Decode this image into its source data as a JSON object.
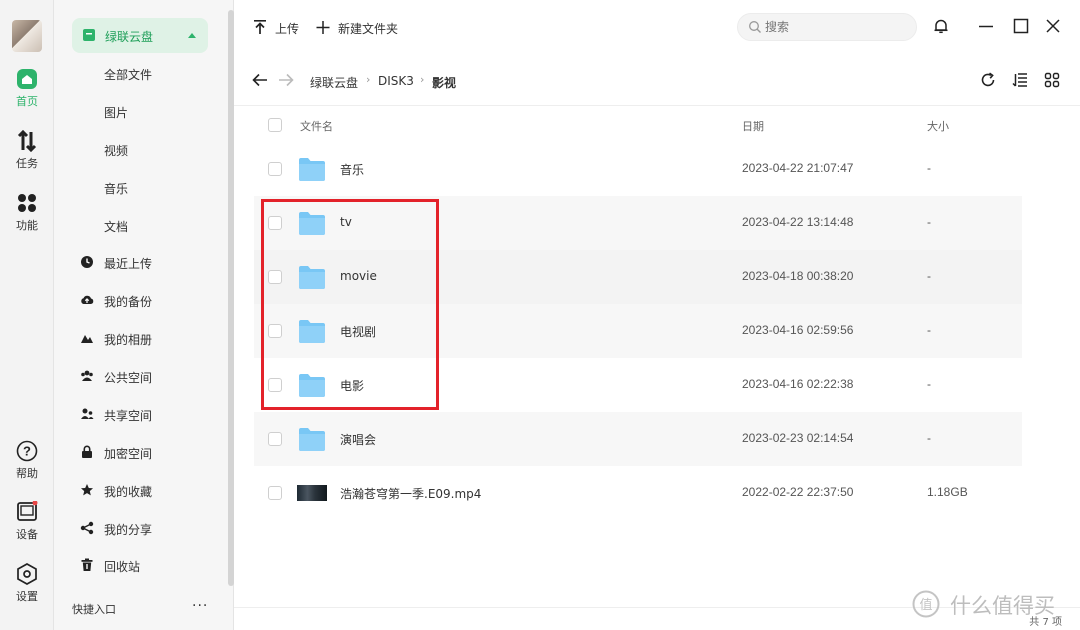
{
  "rail": {
    "items": [
      {
        "label": "首页"
      },
      {
        "label": "任务"
      },
      {
        "label": "功能"
      },
      {
        "label": "帮助"
      },
      {
        "label": "设备"
      },
      {
        "label": "设置"
      }
    ],
    "accent": "#2db36b"
  },
  "sidebar": {
    "cloud_label": "绿联云盘",
    "sub_items": [
      "全部文件",
      "图片",
      "视频",
      "音乐",
      "文档"
    ],
    "nav_items": [
      {
        "label": "最近上传",
        "icon": "clock-icon"
      },
      {
        "label": "我的备份",
        "icon": "cloud-upload-icon"
      },
      {
        "label": "我的相册",
        "icon": "mountain-icon"
      },
      {
        "label": "公共空间",
        "icon": "group-icon"
      },
      {
        "label": "共享空间",
        "icon": "share-users-icon"
      },
      {
        "label": "加密空间",
        "icon": "lock-icon"
      },
      {
        "label": "我的收藏",
        "icon": "star-icon"
      },
      {
        "label": "我的分享",
        "icon": "share-icon"
      },
      {
        "label": "回收站",
        "icon": "trash-icon"
      }
    ],
    "quick_label": "快捷入口",
    "more_label": "···"
  },
  "toolbar": {
    "upload_label": "上传",
    "new_folder_label": "新建文件夹",
    "search_placeholder": "搜索"
  },
  "breadcrumb": {
    "items": [
      "绿联云盘",
      "DISK3",
      "影视"
    ],
    "separator": "›"
  },
  "table": {
    "headers": {
      "name": "文件名",
      "date": "日期",
      "size": "大小"
    },
    "rows": [
      {
        "name": "音乐",
        "date": "2023-04-22 21:07:47",
        "size": "-",
        "type": "folder"
      },
      {
        "name": "tv",
        "date": "2023-04-22 13:14:48",
        "size": "-",
        "type": "folder"
      },
      {
        "name": "movie",
        "date": "2023-04-18 00:38:20",
        "size": "-",
        "type": "folder"
      },
      {
        "name": "电视剧",
        "date": "2023-04-16 02:59:56",
        "size": "-",
        "type": "folder"
      },
      {
        "name": "电影",
        "date": "2023-04-16 02:22:38",
        "size": "-",
        "type": "folder"
      },
      {
        "name": "演唱会",
        "date": "2023-02-23 02:14:54",
        "size": "-",
        "type": "folder"
      },
      {
        "name": "浩瀚苍穹第一季.E09.mp4",
        "date": "2022-02-22 22:37:50",
        "size": "1.18GB",
        "type": "video"
      }
    ]
  },
  "footer": {
    "total": "共 7 项"
  },
  "watermark": {
    "text": "什么值得买",
    "glyph": "值"
  },
  "colors": {
    "accent": "#2db36b",
    "folder": "#79c7f5",
    "highlight": "#e3222a"
  }
}
